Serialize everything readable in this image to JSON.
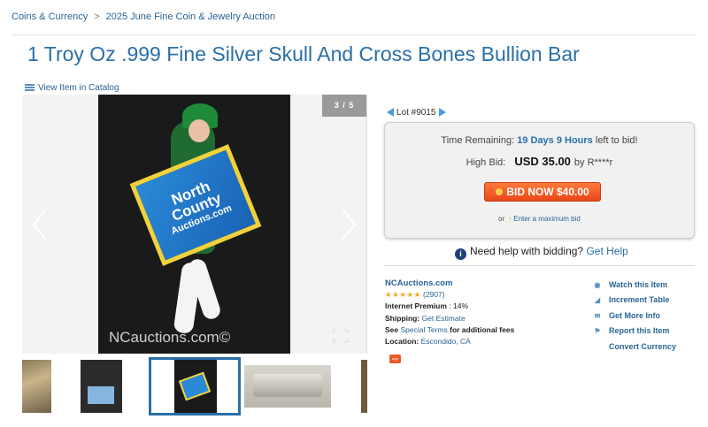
{
  "breadcrumb": {
    "items": [
      "Coins & Currency",
      "2025 June Fine Coin & Jewelry Auction"
    ],
    "separator": ">"
  },
  "title": "1 Troy Oz .999 Fine Silver Skull And Cross Bones Bullion Bar",
  "catalog_link": "View Item in Catalog",
  "gallery": {
    "counter": "3 / 5",
    "sign_line1": "North",
    "sign_line2": "County",
    "sign_line3": "Auctions.com",
    "watermark": "NCauctions.com©",
    "thumb_watermark": "NCauctions.com©"
  },
  "lot": "Lot #9015",
  "bid": {
    "time_label": "Time Remaining:",
    "time_value": "19 Days 9 Hours",
    "time_suffix": "left to bid!",
    "high_label": "High Bid:",
    "high_amount": "USD 35.00",
    "high_by": "by R****r",
    "button": "BID NOW $40.00",
    "or": "or",
    "max_link": "Enter a maximum bid"
  },
  "help": {
    "text": "Need help with bidding?",
    "link": "Get Help"
  },
  "seller": {
    "name": "NCAuctions.com",
    "stars": "★★★★★",
    "count": "(2907)",
    "premium_label": "Internet Premium",
    "premium_value": ": 14%",
    "shipping_label": "Shipping:",
    "shipping_value": "Get Estimate",
    "see": "See",
    "special_terms": "Special Terms",
    "fees": "for additional fees",
    "location_label": "Location:",
    "location_value": "Escondido, CA",
    "badge": "sign"
  },
  "actions": [
    "Watch this Item",
    "Increment Table",
    "Get More Info",
    "Report this Item",
    "Convert Currency"
  ],
  "colors": {
    "link": "#2a6496",
    "title": "#2a6fa8",
    "bid_button": "#e8461a",
    "stars": "#f5a623"
  }
}
